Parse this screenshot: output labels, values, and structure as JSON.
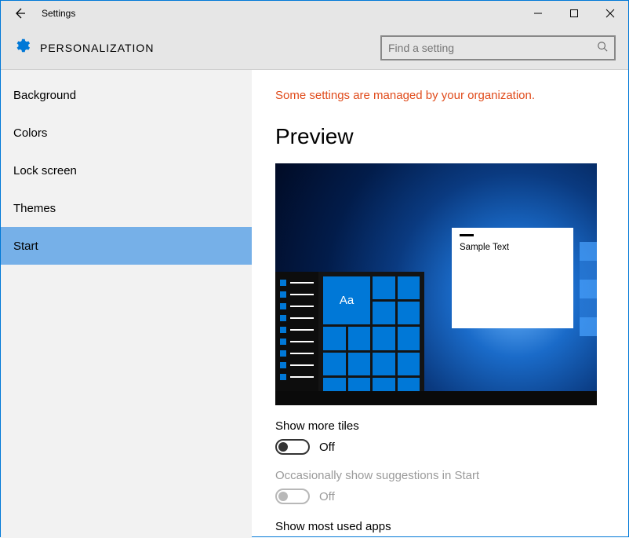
{
  "titlebar": {
    "title": "Settings"
  },
  "header": {
    "section": "PERSONALIZATION",
    "search_placeholder": "Find a setting"
  },
  "sidebar": {
    "items": [
      {
        "label": "Background",
        "selected": false
      },
      {
        "label": "Colors",
        "selected": false
      },
      {
        "label": "Lock screen",
        "selected": false
      },
      {
        "label": "Themes",
        "selected": false
      },
      {
        "label": "Start",
        "selected": true
      }
    ]
  },
  "content": {
    "notice": "Some settings are managed by your organization.",
    "preview_heading": "Preview",
    "sample_window_text": "Sample Text",
    "tile_label": "Aa",
    "settings": [
      {
        "label": "Show more tiles",
        "state": "Off",
        "enabled": true
      },
      {
        "label": "Occasionally show suggestions in Start",
        "state": "Off",
        "enabled": false
      }
    ],
    "cutoff_label": "Show most used apps"
  }
}
